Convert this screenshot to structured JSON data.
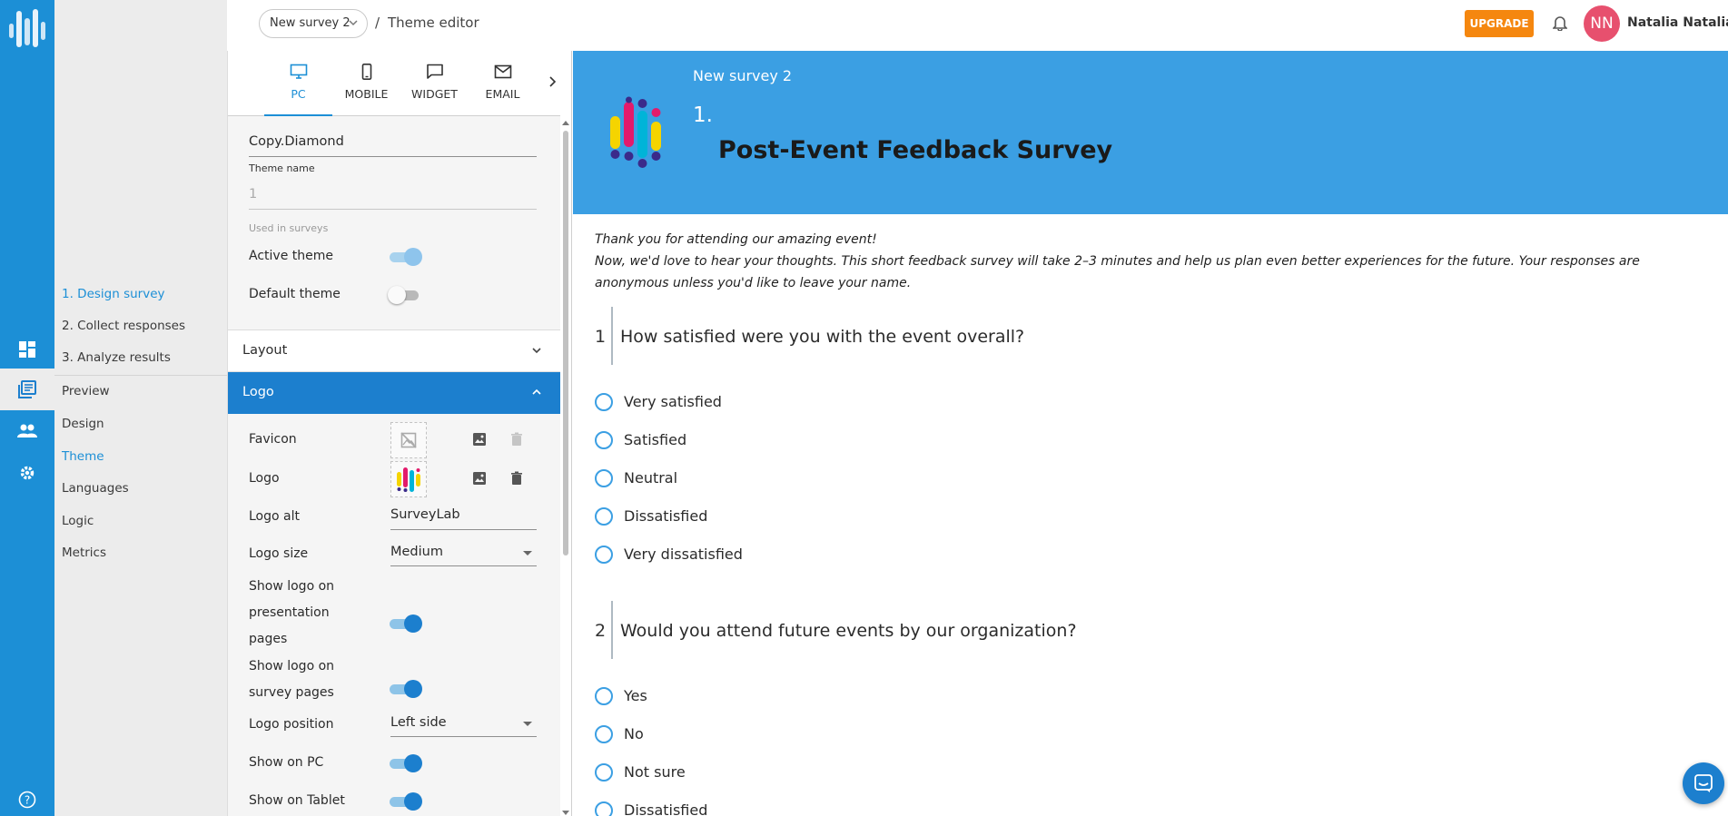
{
  "topbar": {
    "survey_selector": "New survey 2",
    "breadcrumb_separator": "/",
    "page_title": "Theme editor",
    "upgrade_label": "UPGRADE",
    "user_initials": "NN",
    "user_name": "Natalia Natalia"
  },
  "sidebar": {
    "steps": [
      "1. Design survey",
      "2. Collect responses",
      "3. Analyze results"
    ],
    "sub_items": [
      "Preview",
      "Design",
      "Theme",
      "Languages",
      "Logic",
      "Metrics"
    ],
    "active_step": "1. Design survey",
    "active_sub_item": "Theme"
  },
  "device_tabs": [
    {
      "label": "PC",
      "icon": "monitor-icon",
      "active": true
    },
    {
      "label": "MOBILE",
      "icon": "phone-icon",
      "active": false
    },
    {
      "label": "WIDGET",
      "icon": "chat-icon",
      "active": false
    },
    {
      "label": "EMAIL",
      "icon": "mail-icon",
      "active": false
    }
  ],
  "theme": {
    "name_value": "Copy.Diamond",
    "name_caption": "Theme name",
    "used_value": "1",
    "used_caption": "Used in surveys",
    "active_label": "Active theme",
    "active_on": true,
    "default_label": "Default theme",
    "default_on": false
  },
  "sections": {
    "layout_label": "Layout",
    "logo_label": "Logo"
  },
  "logo": {
    "favicon_label": "Favicon",
    "logo_label": "Logo",
    "logo_alt_label": "Logo alt",
    "logo_alt_value": "SurveyLab",
    "logo_size_label": "Logo size",
    "logo_size_value": "Medium",
    "show_presentation_label": "Show logo on presentation pages",
    "show_presentation_on": true,
    "show_survey_label": "Show logo on survey pages",
    "show_survey_on": true,
    "position_label": "Logo position",
    "position_value": "Left side",
    "show_pc_label": "Show on PC",
    "show_pc_on": true,
    "show_tablet_label": "Show on Tablet",
    "show_tablet_on": true
  },
  "preview": {
    "survey_name": "New survey 2",
    "page_number": "1.",
    "survey_title": "Post-Event Feedback Survey",
    "intro_line1": "Thank you for attending our amazing event!",
    "intro_line2": "Now, we'd love to hear your thoughts. This short feedback survey will take 2–3 minutes and help us plan even better experiences for the future. Your responses are anonymous unless you'd like to leave your name.",
    "questions": [
      {
        "number": "1",
        "text": "How satisfied were you with the event overall?",
        "options": [
          "Very satisfied",
          "Satisfied",
          "Neutral",
          "Dissatisfied",
          "Very dissatisfied"
        ]
      },
      {
        "number": "2",
        "text": "Would you attend future events by our organization?",
        "options": [
          "Yes",
          "No",
          "Not sure",
          "Dissatisfied"
        ]
      }
    ]
  },
  "colors": {
    "brand_blue": "#1c8fd6",
    "accent_blue": "#1c7fce",
    "banner_blue": "#3b9fe3",
    "upgrade_orange": "#f5870f",
    "avatar_pink": "#e7506e"
  }
}
